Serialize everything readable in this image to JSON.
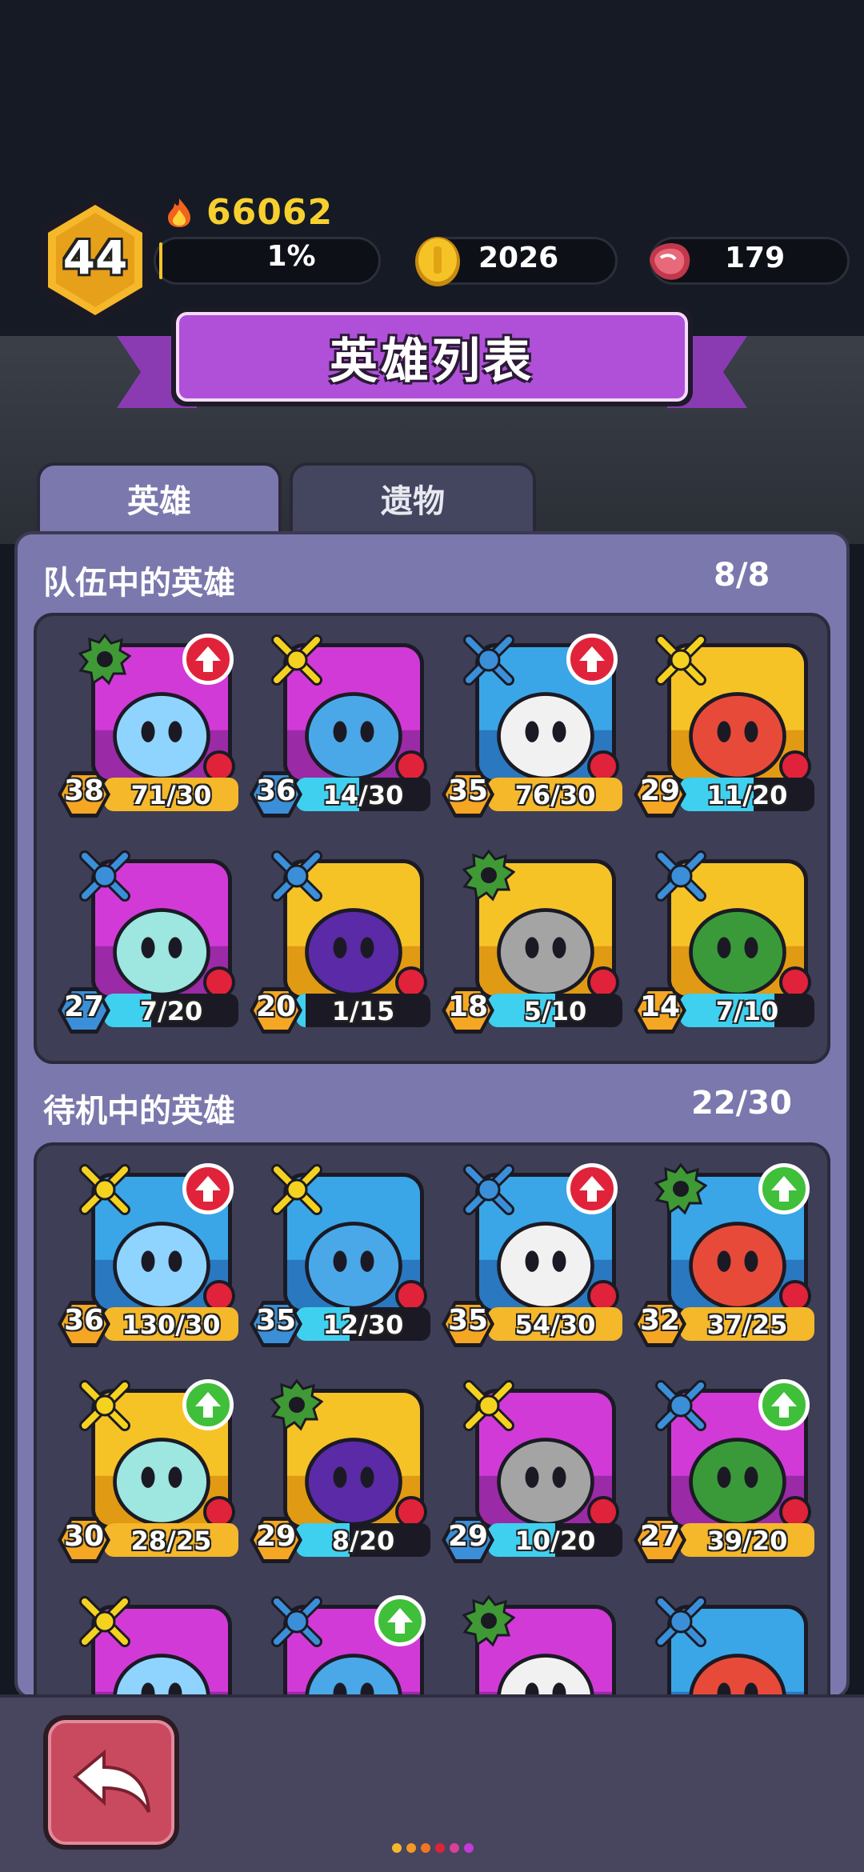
{
  "player": {
    "level": "44",
    "power": "66062",
    "xp_percent_label": "1%",
    "xp_fraction": 0.01
  },
  "resources": {
    "coins": "2026",
    "meat": "179"
  },
  "title": "英雄列表",
  "tabs": {
    "heroes": "英雄",
    "relics": "遗物"
  },
  "team": {
    "title": "队伍中的英雄",
    "count": "8/8",
    "heroes": [
      {
        "level": "38",
        "shards": "71/30",
        "progress": 1.0,
        "class": "support",
        "upgrade": "red",
        "theme": "magenta"
      },
      {
        "level": "36",
        "shards": "14/30",
        "progress": 0.47,
        "class": "assassin",
        "upgrade": "none",
        "theme": "magenta"
      },
      {
        "level": "35",
        "shards": "76/30",
        "progress": 1.0,
        "class": "mage",
        "upgrade": "red",
        "theme": "blue"
      },
      {
        "level": "29",
        "shards": "11/20",
        "progress": 0.55,
        "class": "assassin",
        "upgrade": "none",
        "theme": "gold"
      },
      {
        "level": "27",
        "shards": "7/20",
        "progress": 0.35,
        "class": "mage",
        "upgrade": "none",
        "theme": "magenta"
      },
      {
        "level": "20",
        "shards": "1/15",
        "progress": 0.07,
        "class": "mage",
        "upgrade": "none",
        "theme": "gold"
      },
      {
        "level": "18",
        "shards": "5/10",
        "progress": 0.5,
        "class": "support",
        "upgrade": "none",
        "theme": "gold"
      },
      {
        "level": "14",
        "shards": "7/10",
        "progress": 0.7,
        "class": "mage",
        "upgrade": "none",
        "theme": "gold"
      }
    ]
  },
  "standby": {
    "title": "待机中的英雄",
    "count": "22/30",
    "heroes": [
      {
        "level": "36",
        "shards": "130/30",
        "progress": 1.0,
        "class": "assassin",
        "upgrade": "red",
        "theme": "blue"
      },
      {
        "level": "35",
        "shards": "12/30",
        "progress": 0.4,
        "class": "assassin",
        "upgrade": "none",
        "theme": "blue"
      },
      {
        "level": "35",
        "shards": "54/30",
        "progress": 1.0,
        "class": "mage",
        "upgrade": "red",
        "theme": "blue"
      },
      {
        "level": "32",
        "shards": "37/25",
        "progress": 1.0,
        "class": "support",
        "upgrade": "green",
        "theme": "blue"
      },
      {
        "level": "30",
        "shards": "28/25",
        "progress": 1.0,
        "class": "assassin",
        "upgrade": "green",
        "theme": "gold"
      },
      {
        "level": "29",
        "shards": "8/20",
        "progress": 0.4,
        "class": "support",
        "upgrade": "none",
        "theme": "gold"
      },
      {
        "level": "29",
        "shards": "10/20",
        "progress": 0.5,
        "class": "assassin",
        "upgrade": "none",
        "theme": "magenta"
      },
      {
        "level": "27",
        "shards": "39/20",
        "progress": 1.0,
        "class": "mage",
        "upgrade": "green",
        "theme": "magenta"
      },
      {
        "level": "",
        "shards": "",
        "progress": 0,
        "class": "assassin",
        "upgrade": "none",
        "theme": "magenta"
      },
      {
        "level": "",
        "shards": "",
        "progress": 0,
        "class": "mage",
        "upgrade": "green",
        "theme": "magenta"
      },
      {
        "level": "",
        "shards": "",
        "progress": 0,
        "class": "support",
        "upgrade": "none",
        "theme": "magenta"
      },
      {
        "level": "",
        "shards": "",
        "progress": 0,
        "class": "mage",
        "upgrade": "none",
        "theme": "blue"
      }
    ]
  },
  "colors": {
    "accent": "#b050d8",
    "gold": "#f5b82a",
    "cyan": "#3fd0f0",
    "red_badge": "#e0233a",
    "green_badge": "#3fbf3a",
    "panel": "#7a78ad"
  }
}
